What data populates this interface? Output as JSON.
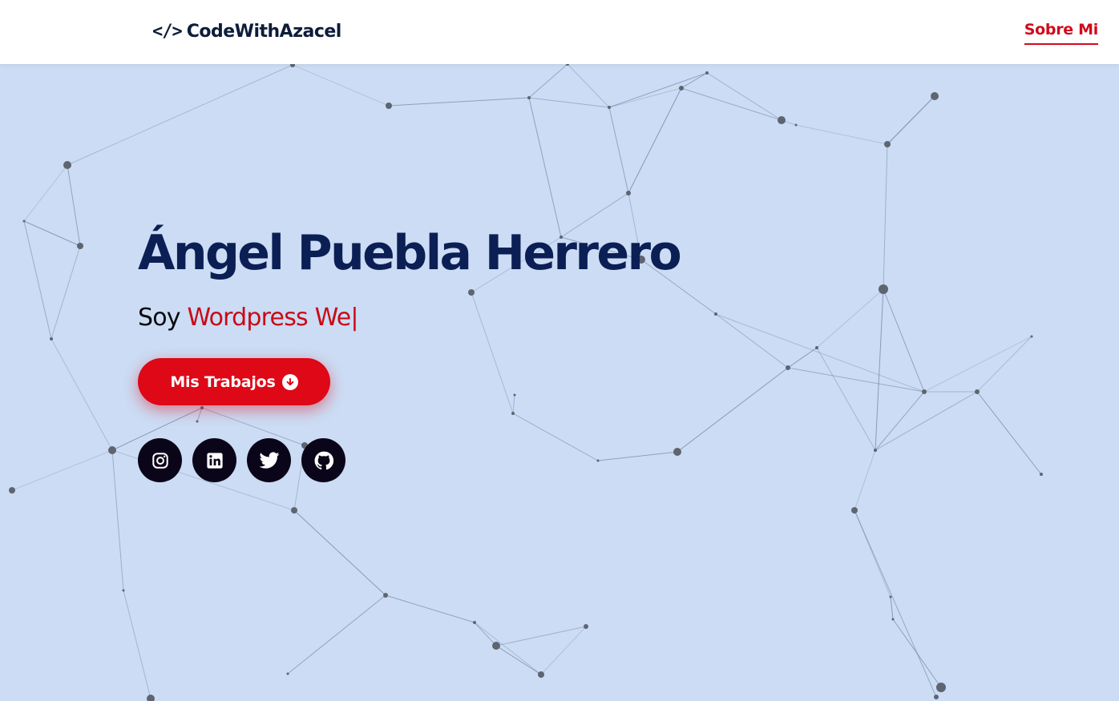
{
  "header": {
    "brand_icon": "</>",
    "brand_name": "CodeWithAzacel",
    "nav_link": "Sobre Mi"
  },
  "hero": {
    "title": "Ángel Puebla Herrero",
    "subtitle_prefix": "Soy",
    "subtitle_typed": "Wordpress We",
    "cursor": "|",
    "cta_label": "Mis Trabajos",
    "cta_icon": "arrow-down-circle-icon"
  },
  "socials": [
    {
      "name": "instagram",
      "icon": "instagram-icon"
    },
    {
      "name": "linkedin",
      "icon": "linkedin-icon"
    },
    {
      "name": "twitter",
      "icon": "twitter-icon"
    },
    {
      "name": "github",
      "icon": "github-icon"
    }
  ],
  "colors": {
    "background": "#cbdcf4",
    "brand_dark": "#0c1c3a",
    "title": "#0b1f55",
    "accent_red": "#de0816",
    "social_bg": "#0b0519"
  }
}
